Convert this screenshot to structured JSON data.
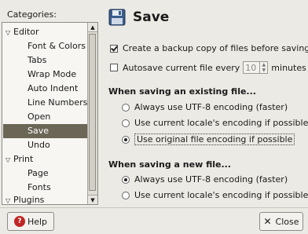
{
  "sidebar": {
    "label": "Categories:",
    "items": [
      {
        "label": "Editor",
        "kind": "parent"
      },
      {
        "label": "Font & Colors",
        "kind": "child"
      },
      {
        "label": "Tabs",
        "kind": "child"
      },
      {
        "label": "Wrap Mode",
        "kind": "child"
      },
      {
        "label": "Auto Indent",
        "kind": "child"
      },
      {
        "label": "Line Numbers",
        "kind": "child"
      },
      {
        "label": "Open",
        "kind": "child"
      },
      {
        "label": "Save",
        "kind": "child",
        "selected": true
      },
      {
        "label": "Undo",
        "kind": "child"
      },
      {
        "label": "Print",
        "kind": "parent"
      },
      {
        "label": "Page",
        "kind": "child"
      },
      {
        "label": "Fonts",
        "kind": "child"
      },
      {
        "label": "Plugins",
        "kind": "parent"
      }
    ]
  },
  "main": {
    "title": "Save",
    "backup_label": "Create a backup copy of files before saving",
    "backup_checked": true,
    "autosave_label": "Autosave current file every",
    "autosave_value": "10",
    "autosave_unit": "minutes",
    "autosave_checked": false,
    "existing_heading": "When saving an existing file...",
    "existing_options": [
      {
        "label": "Always use UTF-8 encoding (faster)",
        "selected": false
      },
      {
        "label": "Use current locale's encoding if possible",
        "selected": false
      },
      {
        "label": "Use original file encoding if possible",
        "selected": true
      }
    ],
    "new_heading": "When saving a new file...",
    "new_options": [
      {
        "label": "Always use UTF-8 encoding (faster)",
        "selected": true
      },
      {
        "label": "Use current locale's encoding if possible",
        "selected": false
      }
    ]
  },
  "footer": {
    "help_label": "Help",
    "close_label": "Close"
  },
  "colors": {
    "selection": "#6b6655",
    "help_icon": "#c02626"
  }
}
